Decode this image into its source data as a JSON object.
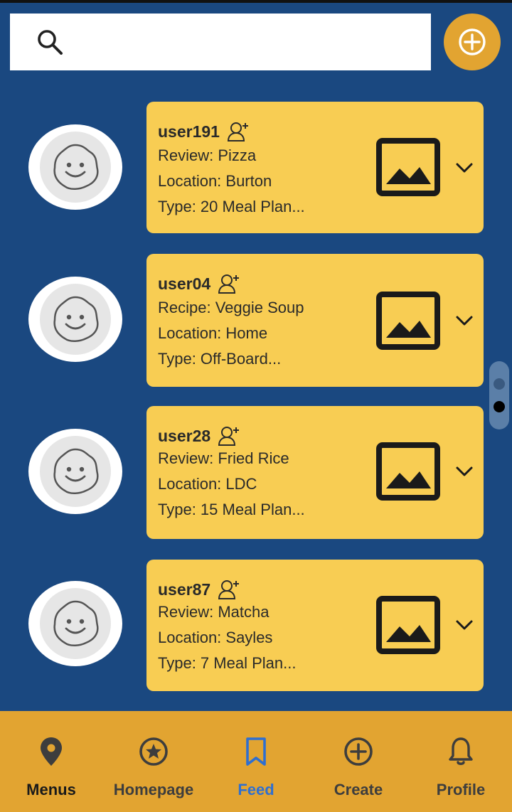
{
  "colors": {
    "background": "#1a4880",
    "card": "#f8cd53",
    "nav_bar": "#e2a431",
    "accent_active": "#2f6fd0",
    "text": "#2a2a2a"
  },
  "search": {
    "placeholder": "",
    "value": ""
  },
  "add_button": {
    "icon": "plus-circle-icon"
  },
  "feed": {
    "posts": [
      {
        "username": "user191",
        "line1": "Review: Pizza",
        "line2": "Location: Burton",
        "line3": "Type: 20 Meal Plan..."
      },
      {
        "username": "user04",
        "line1": "Recipe: Veggie Soup",
        "line2": "Location: Home",
        "line3": "Type: Off-Board..."
      },
      {
        "username": "user28",
        "line1": "Review: Fried Rice",
        "line2": "Location: LDC",
        "line3": "Type: 15 Meal Plan..."
      },
      {
        "username": "user87",
        "line1": "Review: Matcha",
        "line2": "Location: Sayles",
        "line3": "Type: 7 Meal Plan..."
      }
    ]
  },
  "scroll_indicator": {
    "pages": 2,
    "active": 2
  },
  "nav": {
    "items": [
      {
        "label": "Menus",
        "icon": "location-pin-icon",
        "active": false
      },
      {
        "label": "Homepage",
        "icon": "star-circle-icon",
        "active": false
      },
      {
        "label": "Feed",
        "icon": "bookmark-icon",
        "active": true
      },
      {
        "label": "Create",
        "icon": "plus-circle-icon",
        "active": false
      },
      {
        "label": "Profile",
        "icon": "bell-icon",
        "active": false
      }
    ]
  }
}
